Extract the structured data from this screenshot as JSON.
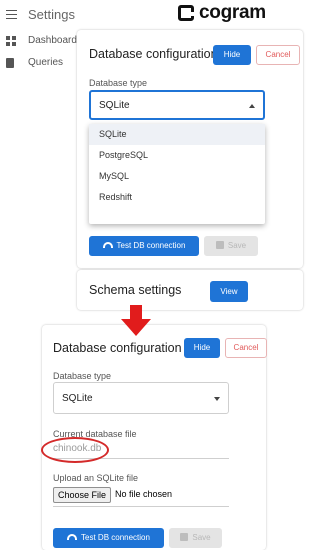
{
  "app": {
    "title": "Settings",
    "logo_text": "cogram"
  },
  "sidebar": {
    "items": [
      {
        "label": "Dashboard",
        "icon": "dashboard-icon"
      },
      {
        "label": "Queries",
        "icon": "book-icon"
      }
    ]
  },
  "before": {
    "db_card": {
      "title": "Database configuration",
      "hide_label": "Hide",
      "cancel_label": "Cancel",
      "db_type_label": "Database type",
      "db_type_value": "SQLite",
      "options": [
        "SQLite",
        "PostgreSQL",
        "MySQL",
        "Redshift"
      ],
      "selected_option": "SQLite",
      "test_label": "Test DB connection",
      "save_label": "Save"
    },
    "schema_card": {
      "title": "Schema settings",
      "view_label": "View"
    }
  },
  "after": {
    "db_card": {
      "title": "Database configuration",
      "hide_label": "Hide",
      "cancel_label": "Cancel",
      "db_type_label": "Database type",
      "db_type_value": "SQLite",
      "current_file_label": "Current database file",
      "current_file_value": "chinook.db",
      "upload_label": "Upload an SQLite file",
      "choose_file_label": "Choose File",
      "no_file_text": "No file chosen",
      "test_label": "Test DB connection",
      "save_label": "Save"
    }
  },
  "colors": {
    "primary": "#1f74d6",
    "cancel": "#e15a5a",
    "annotation": "#d42a2a"
  }
}
